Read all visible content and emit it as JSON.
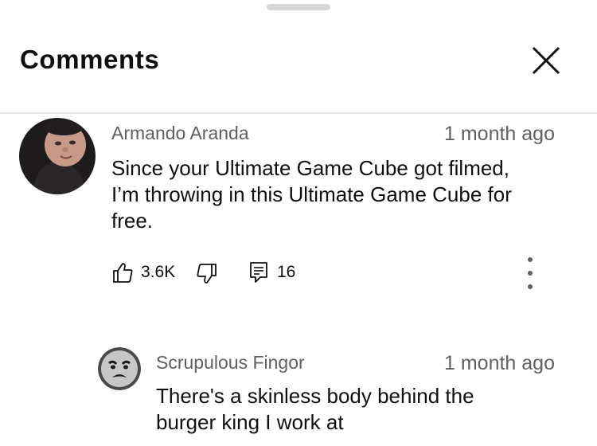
{
  "header": {
    "title": "Comments"
  },
  "icons": {
    "close": "close-icon",
    "like": "thumbs-up-icon",
    "dislike": "thumbs-down-icon",
    "replies": "comment-icon",
    "more": "more-vertical-icon"
  },
  "colors": {
    "text_primary": "#0f0f0f",
    "text_secondary": "#606060",
    "divider": "#e5e5e5",
    "handle": "#d7d7d7",
    "background": "#ffffff"
  },
  "comments": [
    {
      "author": "Armando Aranda",
      "time": "1 month ago",
      "text_line1": "Since your Ultimate Game Cube got filmed,",
      "text_line2": "I’m throwing in this Ultimate Game Cube for",
      "text_line3": "free.",
      "likes": "3.6K",
      "replies": "16"
    }
  ],
  "replies": [
    {
      "author": "Scrupulous Fingor",
      "time": "1 month ago",
      "text_line1": "There's a skinless body behind the",
      "text_line2": "burger king I work at"
    }
  ]
}
